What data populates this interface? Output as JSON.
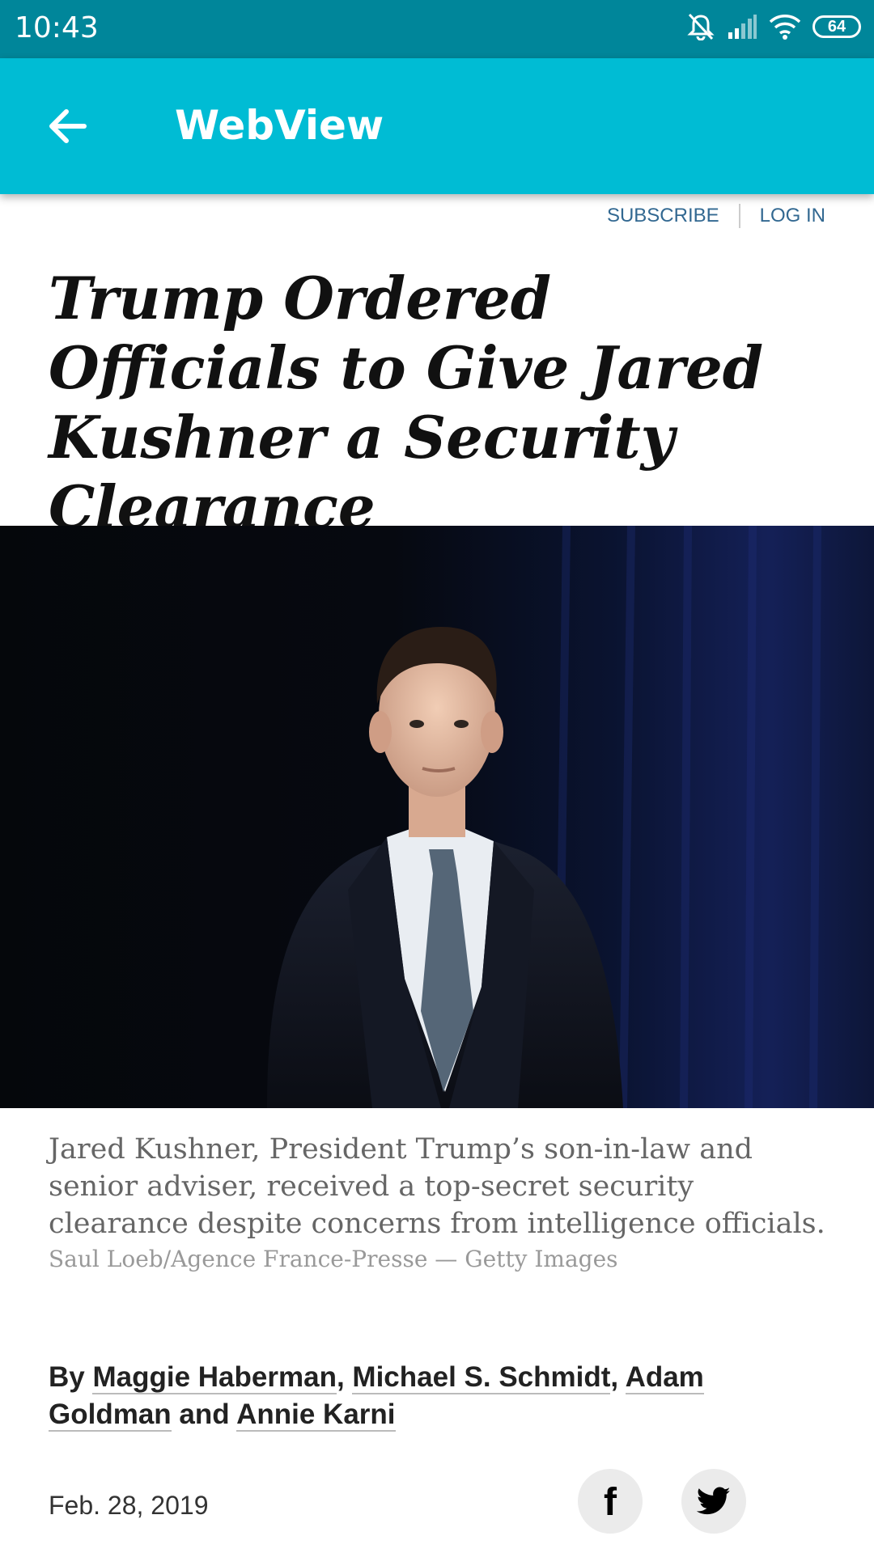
{
  "status_bar": {
    "time": "10:43",
    "battery": "64"
  },
  "app_bar": {
    "title": "WebView"
  },
  "site_nav": {
    "subscribe": "SUBSCRIBE",
    "login": "LOG IN"
  },
  "article": {
    "headline": "Trump Ordered Officials to Give Jared Kushner a Security Clearance",
    "caption": "Jared Kushner, President Trump’s son-in-law and senior adviser, received a top-secret security clearance despite concerns from intelligence officials.",
    "credit": "Saul Loeb/Agence France-Presse — Getty Images",
    "byline": {
      "prefix": "By",
      "authors": [
        "Maggie Haberman",
        "Michael S. Schmidt",
        "Adam Goldman",
        "Annie Karni"
      ],
      "sep1": ",",
      "sep2": ",",
      "conj": "and"
    },
    "date": "Feb. 28, 2019"
  },
  "share": {
    "facebook_glyph": "f",
    "facebook_icon": "facebook-icon",
    "twitter_icon": "twitter-icon"
  },
  "colors": {
    "status_bar": "#00869a",
    "app_bar": "#00bcd4",
    "link": "#326891"
  }
}
